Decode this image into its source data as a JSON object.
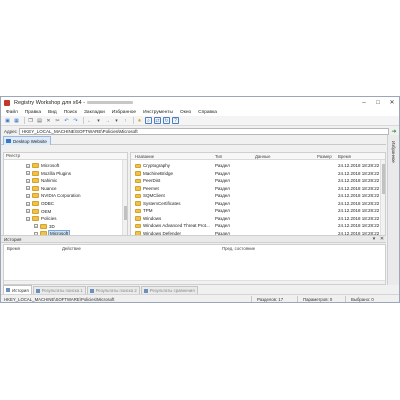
{
  "window": {
    "title": "Registry Workshop для x64 - ",
    "controls": {
      "minimize": "–",
      "maximize": "□",
      "close": "✕"
    }
  },
  "menu": [
    "Файл",
    "Правка",
    "Вид",
    "Поиск",
    "Закладки",
    "Избранное",
    "Инструменты",
    "Окно",
    "Справка"
  ],
  "toolbar": {
    "icons": [
      "computer-icon",
      "registry-icon",
      "copy-icon",
      "paste-icon",
      "delete-icon",
      "cut-icon",
      "undo-icon",
      "redo-icon",
      "back-icon",
      "forward-icon",
      "up-icon",
      "favorites-icon",
      "search-icon",
      "compare-icon",
      "refresh-icon",
      "help-icon"
    ]
  },
  "address": {
    "label": "Адрес",
    "value": "HKEY_LOCAL_MACHINE\\SOFTWARE\\Policies\\Microsoft"
  },
  "document_tab": {
    "label": "Desktop Website"
  },
  "side_panel": {
    "label": "Избранное"
  },
  "tree": {
    "header": "Реестр",
    "items": [
      {
        "label": "Microsoft",
        "indent": 1,
        "selected": false
      },
      {
        "label": "Mozilla Plugins",
        "indent": 1,
        "selected": false
      },
      {
        "label": "Nahimic",
        "indent": 1,
        "selected": false
      },
      {
        "label": "Nuance",
        "indent": 1,
        "selected": false
      },
      {
        "label": "NVIDIA Corporation",
        "indent": 1,
        "selected": false
      },
      {
        "label": "ODBC",
        "indent": 1,
        "selected": false
      },
      {
        "label": "OEM",
        "indent": 1,
        "selected": false
      },
      {
        "label": "Policies",
        "indent": 1,
        "selected": false
      },
      {
        "label": "3D",
        "indent": 2,
        "selected": false
      },
      {
        "label": "Microsoft",
        "indent": 2,
        "selected": true
      }
    ]
  },
  "list": {
    "columns": {
      "name": "Название",
      "type": "Тип",
      "data": "Данные",
      "size": "Размер",
      "time": "Время"
    },
    "rows": [
      {
        "name": "Cryptography",
        "type": "Раздел",
        "time": "24.12.2018 18:28:22"
      },
      {
        "name": "MachineBridge",
        "type": "Раздел",
        "time": "24.12.2018 18:28:22"
      },
      {
        "name": "PeerDist",
        "type": "Раздел",
        "time": "24.12.2018 18:28:22"
      },
      {
        "name": "Peernet",
        "type": "Раздел",
        "time": "24.12.2018 18:28:22"
      },
      {
        "name": "SQMClient",
        "type": "Раздел",
        "time": "24.12.2018 18:28:22"
      },
      {
        "name": "SystemCertificates",
        "type": "Раздел",
        "time": "24.12.2018 18:28:22"
      },
      {
        "name": "TPM",
        "type": "Раздел",
        "time": "24.12.2018 18:28:22"
      },
      {
        "name": "Windows",
        "type": "Раздел",
        "time": "24.12.2018 18:28:22"
      },
      {
        "name": "Windows Advanced Threat Prot...",
        "type": "Раздел",
        "time": "24.12.2018 18:28:22"
      },
      {
        "name": "Windows Defender",
        "type": "Раздел",
        "time": "24.12.2018 18:28:22"
      }
    ]
  },
  "history": {
    "title": "История",
    "controls": {
      "pin": "▾",
      "close": "✕"
    },
    "columns": {
      "time": "Время",
      "action": "Действие",
      "key": "",
      "previous": "Пред. состояние"
    }
  },
  "bottom_tabs": [
    {
      "label": "История",
      "active": true
    },
    {
      "label": "Результаты поиска 1",
      "active": false
    },
    {
      "label": "Результаты поиска 2",
      "active": false
    },
    {
      "label": "Результаты сравнения",
      "active": false
    }
  ],
  "status": {
    "path": "HKEY_LOCAL_MACHINE\\SOFTWARE\\Policies\\Microsoft",
    "sections": "Разделов: 17",
    "params": "Параметров: 0",
    "selected": "Выбрано: 0"
  },
  "colors": {
    "accent": "#3a78c6",
    "folder": "#f0c24b",
    "selection": "#cde3f7"
  }
}
